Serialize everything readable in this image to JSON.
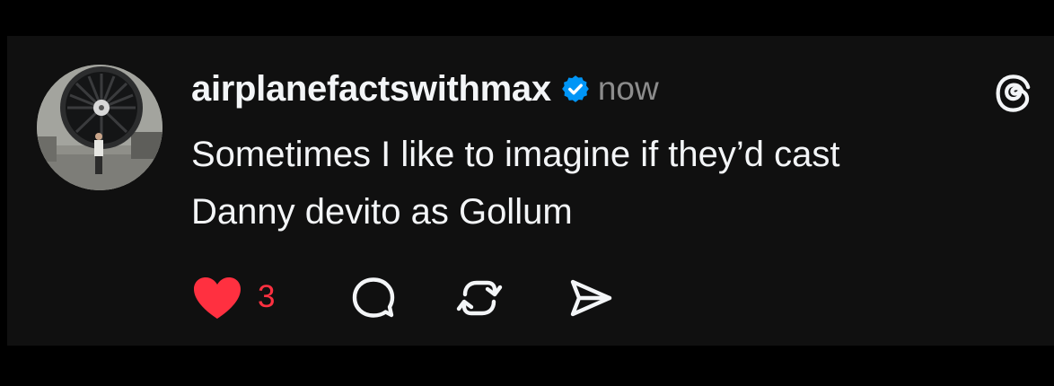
{
  "post": {
    "author": {
      "username": "airplanefactswithmax",
      "verified": true,
      "avatar_icon": "avatar-photo-jet-engine"
    },
    "timestamp": "now",
    "text_line_1": "Sometimes I like to imagine if they’d cast",
    "text_line_2": "Danny devito as Gollum",
    "app_logo_icon": "threads-logo-icon",
    "actions": {
      "like": {
        "icon": "heart-icon",
        "liked": true,
        "count": "3"
      },
      "comment": {
        "icon": "comment-icon"
      },
      "repost": {
        "icon": "repost-icon"
      },
      "share": {
        "icon": "share-icon"
      }
    }
  },
  "colors": {
    "background": "#000000",
    "card": "#101010",
    "text": "#f3f5f7",
    "secondary_text": "#8c8c8c",
    "like": "#ff3040",
    "verified": "#0095f6"
  }
}
